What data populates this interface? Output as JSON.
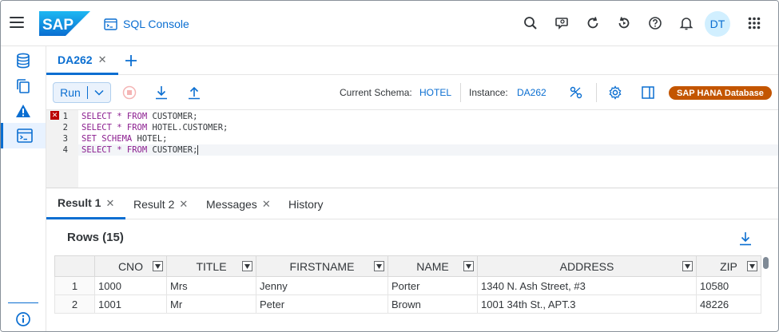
{
  "shell": {
    "app_title": "SQL Console",
    "avatar_initials": "DT",
    "icons": [
      "menu-icon",
      "search-icon",
      "feedback-icon",
      "refresh-icon",
      "history-icon",
      "help-icon",
      "notification-icon",
      "apps-icon"
    ]
  },
  "sidebar": {
    "items": [
      {
        "name": "database-explorer-icon"
      },
      {
        "name": "copy-icon"
      },
      {
        "name": "warning-icon"
      },
      {
        "name": "sql-console-icon",
        "active": true
      }
    ]
  },
  "editor_tabs": {
    "tabs": [
      {
        "label": "DA262",
        "active": true
      }
    ],
    "add_icon": "plus-icon"
  },
  "toolbar": {
    "run_label": "Run",
    "schema_label": "Current Schema:",
    "schema_value": "HOTEL",
    "instance_label": "Instance:",
    "instance_value": "DA262",
    "database_badge": "SAP HANA Database"
  },
  "editor": {
    "lines": [
      {
        "number": "1",
        "keyword": "SELECT * FROM",
        "rest": " CUSTOMER;",
        "error": true
      },
      {
        "number": "2",
        "keyword": "SELECT * FROM",
        "rest": " HOTEL.CUSTOMER;"
      },
      {
        "number": "3",
        "keyword": "SET SCHEMA",
        "rest": " HOTEL;"
      },
      {
        "number": "4",
        "keyword": "SELECT * FROM",
        "rest": " CUSTOMER;",
        "current": true
      }
    ]
  },
  "result_tabs": [
    {
      "label": "Result 1",
      "closable": true,
      "active": true
    },
    {
      "label": "Result 2",
      "closable": true
    },
    {
      "label": "Messages",
      "closable": true
    },
    {
      "label": "History",
      "closable": false
    }
  ],
  "result": {
    "rows_title": "Rows (15)",
    "columns": [
      "",
      "CNO",
      "TITLE",
      "FIRSTNAME",
      "NAME",
      "ADDRESS",
      "ZIP"
    ],
    "rows": [
      [
        "1",
        "1000",
        "Mrs",
        "Jenny",
        "Porter",
        "1340 N. Ash Street, #3",
        "10580"
      ],
      [
        "2",
        "1001",
        "Mr",
        "Peter",
        "Brown",
        "1001 34th St., APT.3",
        "48226"
      ]
    ]
  },
  "colors": {
    "accent": "#0a6ed1",
    "badge": "#c35500",
    "error": "#bb0000",
    "keyword": "#8b1d8f"
  }
}
